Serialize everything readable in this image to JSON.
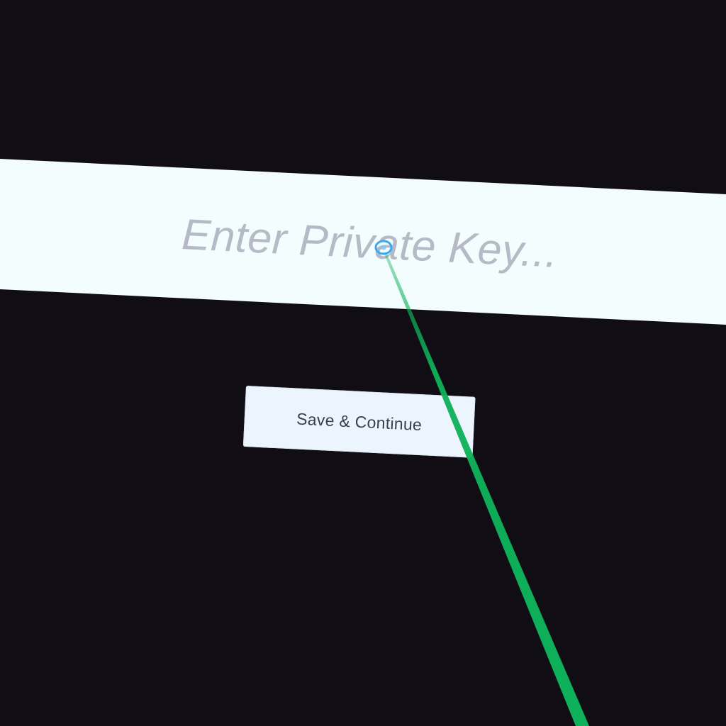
{
  "private_key_input": {
    "value": "",
    "placeholder": "Enter Private Key..."
  },
  "save_button": {
    "label": "Save & Continue"
  },
  "pointer": {
    "icon": "laser-pointer-ray",
    "ray_color": "#0fb15a",
    "cursor_color": "#3aa8f0"
  },
  "colors": {
    "background": "#110d14",
    "panel": "#f3fdfe",
    "placeholder_text": "#b5bac6",
    "button_background": "#ecf5fd",
    "button_text": "#3a3f4a"
  }
}
